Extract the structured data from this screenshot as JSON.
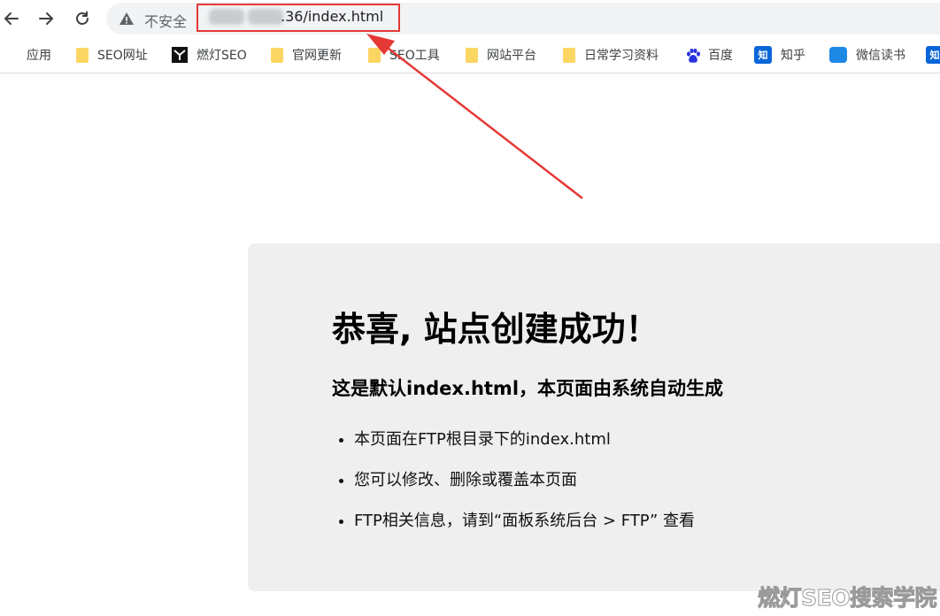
{
  "browser": {
    "security_label": "不安全",
    "url_visible": ".36/index.html"
  },
  "bookmarks": [
    {
      "label": "应用",
      "icon": "apps-grid-icon"
    },
    {
      "label": "SEO网址",
      "icon": "folder-icon"
    },
    {
      "label": "燃灯SEO",
      "icon": "site-icon"
    },
    {
      "label": "官网更新",
      "icon": "folder-icon"
    },
    {
      "label": "SEO工具",
      "icon": "folder-icon"
    },
    {
      "label": "网站平台",
      "icon": "folder-icon"
    },
    {
      "label": "日常学习资料",
      "icon": "folder-icon"
    },
    {
      "label": "百度",
      "icon": "baidu-paw-icon"
    },
    {
      "label": "知乎",
      "icon": "zhihu-icon"
    },
    {
      "label": "微信读书",
      "icon": "weread-icon"
    }
  ],
  "zhihu_icon_text": "知",
  "page": {
    "title": "恭喜, 站点创建成功！",
    "subtitle": "这是默认index.html，本页面由系统自动生成",
    "items": [
      "本页面在FTP根目录下的index.html",
      "您可以修改、删除或覆盖本页面",
      "FTP相关信息，请到“面板系统后台 > FTP” 查看"
    ]
  },
  "watermark": "燃灯SEO搜索学院",
  "colors": {
    "highlight": "#e53935",
    "card_bg": "#efefef",
    "folder": "#fcd663"
  }
}
